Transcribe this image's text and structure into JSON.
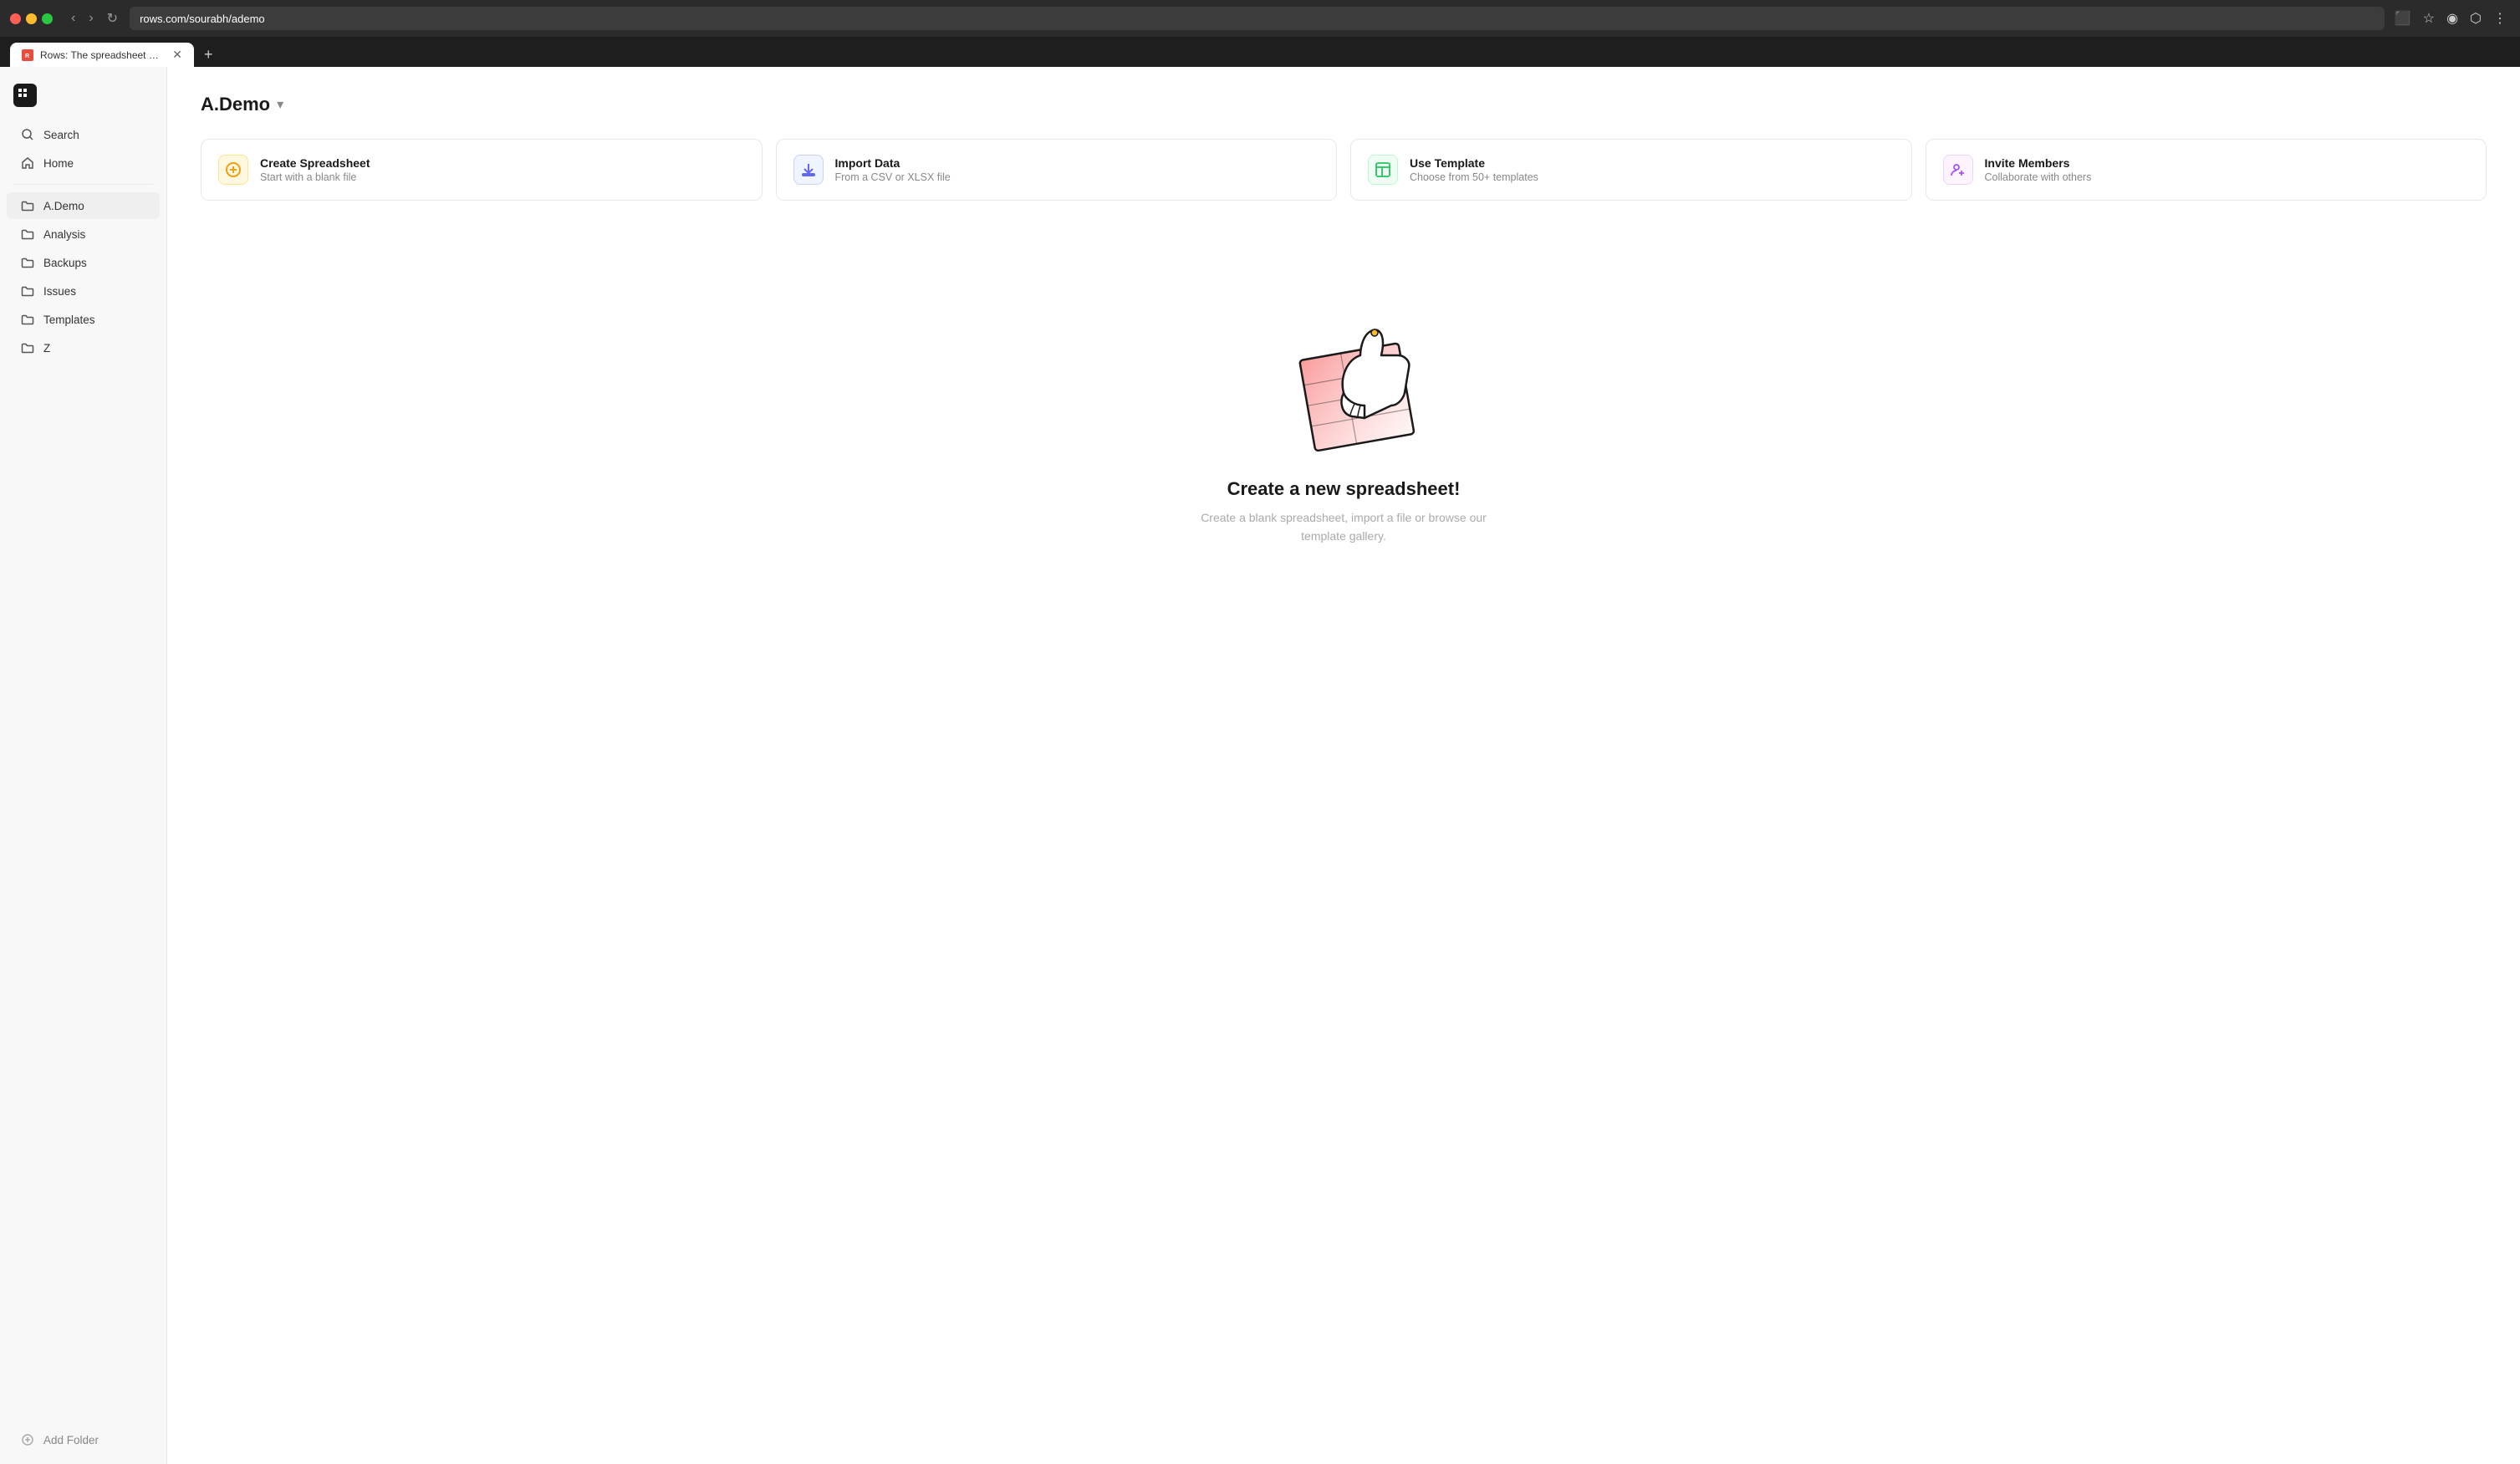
{
  "browser": {
    "url": "rows.com/sourabh/ademo",
    "tab_title": "Rows: The spreadsheet whe...",
    "tab_favicon_color": "#e74c3c"
  },
  "sidebar": {
    "logo_icon": "R",
    "items": [
      {
        "id": "search",
        "label": "Search",
        "icon": "search"
      },
      {
        "id": "home",
        "label": "Home",
        "icon": "home"
      },
      {
        "id": "ademo",
        "label": "A.Demo",
        "icon": "folder",
        "active": true
      },
      {
        "id": "analysis",
        "label": "Analysis",
        "icon": "folder"
      },
      {
        "id": "backups",
        "label": "Backups",
        "icon": "folder"
      },
      {
        "id": "issues",
        "label": "Issues",
        "icon": "folder"
      },
      {
        "id": "templates",
        "label": "Templates",
        "icon": "folder"
      },
      {
        "id": "z",
        "label": "Z",
        "icon": "folder"
      }
    ],
    "add_folder_label": "Add Folder"
  },
  "workspace": {
    "title": "A.Demo",
    "chevron": "▾"
  },
  "action_cards": [
    {
      "id": "create-spreadsheet",
      "icon": "＋",
      "icon_style": "create",
      "title": "Create Spreadsheet",
      "subtitle": "Start with a blank file"
    },
    {
      "id": "import-data",
      "icon": "⬇",
      "icon_style": "import",
      "title": "Import Data",
      "subtitle": "From a CSV or XLSX file"
    },
    {
      "id": "use-template",
      "icon": "▦",
      "icon_style": "template",
      "title": "Use Template",
      "subtitle": "Choose from 50+ templates"
    },
    {
      "id": "invite-members",
      "icon": "👤",
      "icon_style": "invite",
      "title": "Invite Members",
      "subtitle": "Collaborate with others"
    }
  ],
  "empty_state": {
    "title": "Create a new spreadsheet!",
    "subtitle": "Create a blank spreadsheet, import a file or browse our template gallery."
  }
}
